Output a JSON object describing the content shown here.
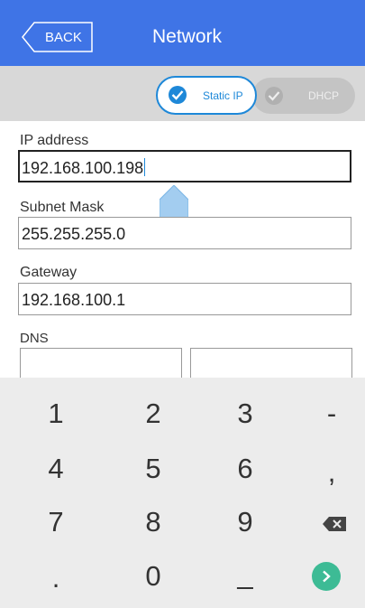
{
  "header": {
    "back_label": "BACK",
    "title": "Network",
    "bg_color": "#3f74e6"
  },
  "mode": {
    "options": [
      {
        "label": "Static IP",
        "selected": true
      },
      {
        "label": "DHCP",
        "selected": false
      }
    ],
    "accent_color": "#1e88d8"
  },
  "form": {
    "ip_label": "IP address",
    "ip_value": "192.168.100.198",
    "subnet_label": "Subnet Mask",
    "subnet_value": "255.255.255.0",
    "gateway_label": "Gateway",
    "gateway_value": "192.168.100.1",
    "dns_label": "DNS",
    "dns1_value": "",
    "dns2_value": ""
  },
  "keyboard": {
    "keys": [
      "1",
      "2",
      "3",
      "-",
      "4",
      "5",
      "6",
      ",",
      "7",
      "8",
      "9",
      "backspace-icon",
      ".",
      "0",
      "_",
      "enter-icon"
    ],
    "enter_color": "#3dbb95"
  }
}
